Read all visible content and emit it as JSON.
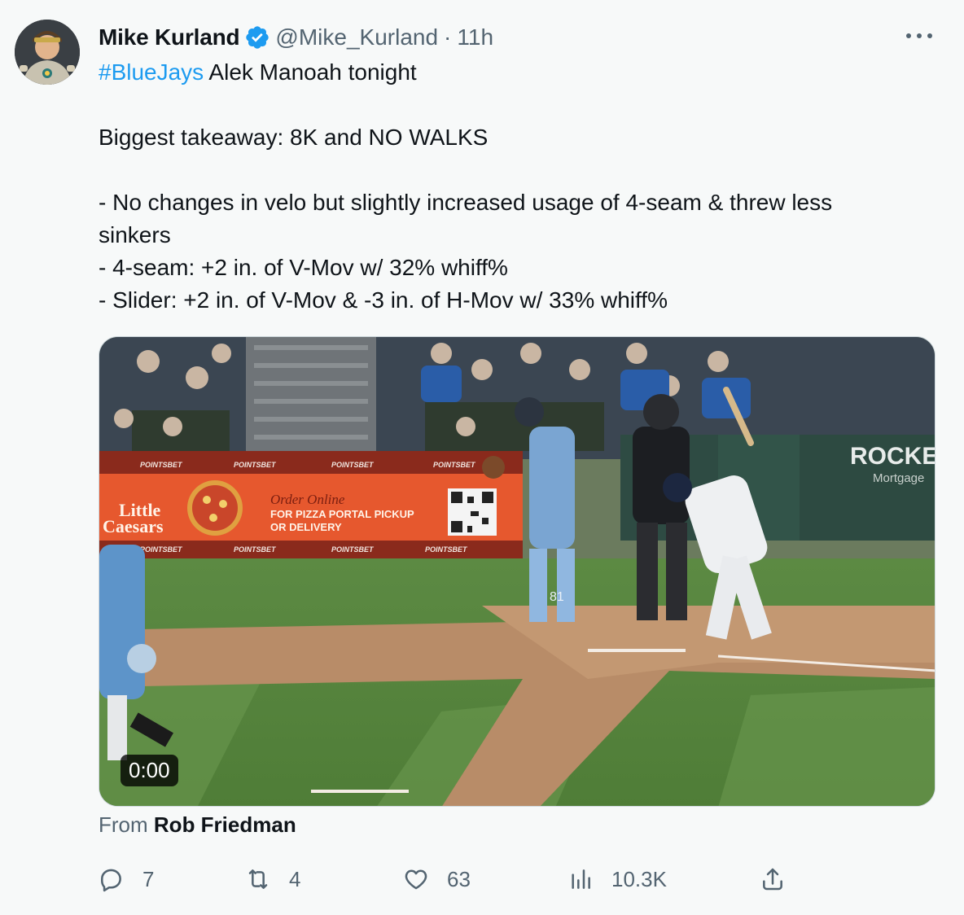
{
  "author": {
    "name": "Mike Kurland",
    "handle": "@Mike_Kurland",
    "separator": "·",
    "time": "11h"
  },
  "tweet": {
    "hashtag": "#BlueJays",
    "line1_rest": " Alek Manoah tonight",
    "line2": "Biggest takeaway: 8K and NO WALKS",
    "line3a": "- No changes in velo but slightly increased usage of 4-seam & threw less",
    "line3b": "sinkers",
    "line4": "- 4-seam: +2 in. of V-Mov w/ 32% whiff%",
    "line5": "- Slider: +2 in. of V-Mov & -3 in. of H-Mov w/ 33% whiff%"
  },
  "media": {
    "duration": "0:00",
    "signage": {
      "sponsor": "POINTSBET",
      "brand_line1": "Little",
      "brand_line2": "Caesars",
      "order_online": "Order Online",
      "pickup_line1": "FOR PIZZA PORTAL PICKUP",
      "pickup_line2": "OR DELIVERY",
      "rocket_line1": "ROCKE",
      "rocket_line2": "Mortgage",
      "catcher_number": "81"
    }
  },
  "attribution": {
    "prefix": "From",
    "source": "Rob Friedman"
  },
  "actions": {
    "replies": "7",
    "retweets": "4",
    "likes": "63",
    "views": "10.3K"
  },
  "colors": {
    "accent": "#1d9bf0",
    "secondary_text": "#536471",
    "background": "#f7f9f9"
  },
  "icons": {
    "verified": "verified-badge-icon",
    "more": "more-icon",
    "reply": "reply-icon",
    "retweet": "retweet-icon",
    "like": "heart-icon",
    "views": "views-icon",
    "share": "share-icon"
  }
}
